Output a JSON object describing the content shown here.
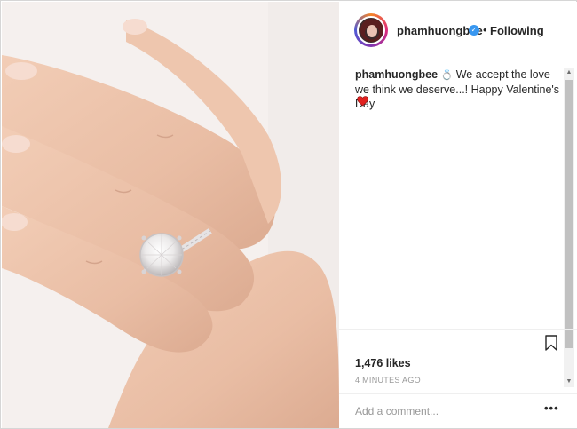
{
  "post": {
    "photo": {
      "description_icon": "hand-ring-photo"
    },
    "author": {
      "username": "phamhuongbee",
      "verified_icon": "verified-badge-icon",
      "separator": "•",
      "follow_status": "Following"
    },
    "caption": {
      "username": "phamhuongbee",
      "emoji": "💍",
      "text": "We accept the love we think we deserve...! Happy Valentine's Day",
      "end_emoji_icon": "heart-icon"
    },
    "likes": "1,476 likes",
    "timestamp": "4 MINUTES AGO",
    "comment": {
      "placeholder": "Add a comment...",
      "more_label": "•••"
    },
    "colors": {
      "verified": "#3897f0",
      "heart": "#e0211f",
      "text": "#262626",
      "muted": "#999999"
    }
  }
}
